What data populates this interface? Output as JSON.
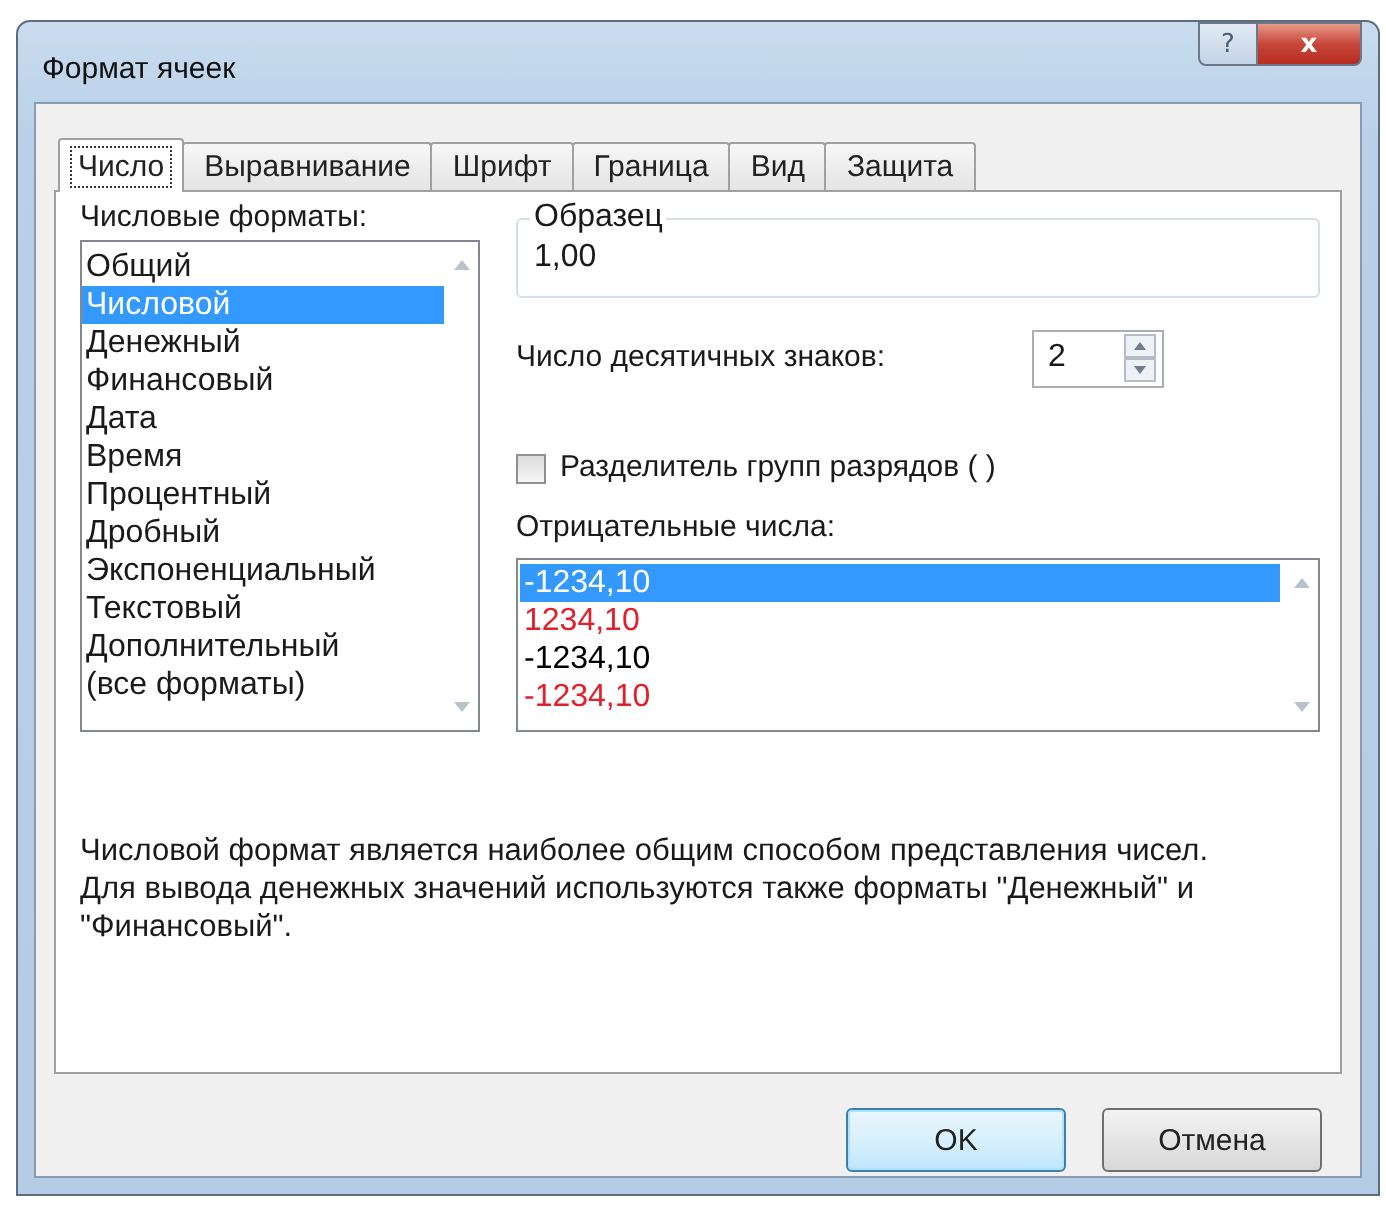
{
  "window": {
    "title": "Формат ячеек",
    "help_button": "?",
    "close_button": "x"
  },
  "tabs": [
    {
      "label": "Число",
      "selected": true
    },
    {
      "label": "Выравнивание",
      "selected": false
    },
    {
      "label": "Шрифт",
      "selected": false
    },
    {
      "label": "Граница",
      "selected": false
    },
    {
      "label": "Вид",
      "selected": false
    },
    {
      "label": "Защита",
      "selected": false
    }
  ],
  "formats": {
    "label": "Числовые форматы:",
    "items": [
      {
        "label": "Общий",
        "selected": false
      },
      {
        "label": "Числовой",
        "selected": true
      },
      {
        "label": "Денежный",
        "selected": false
      },
      {
        "label": "Финансовый",
        "selected": false
      },
      {
        "label": "Дата",
        "selected": false
      },
      {
        "label": "Время",
        "selected": false
      },
      {
        "label": "Процентный",
        "selected": false
      },
      {
        "label": "Дробный",
        "selected": false
      },
      {
        "label": "Экспоненциальный",
        "selected": false
      },
      {
        "label": "Текстовый",
        "selected": false
      },
      {
        "label": "Дополнительный",
        "selected": false
      },
      {
        "label": "(все форматы)",
        "selected": false
      }
    ]
  },
  "sample": {
    "label": "Образец",
    "value": "1,00"
  },
  "decimal_places": {
    "label": "Число десятичных знаков:",
    "value": "2"
  },
  "thousands_separator": {
    "label": "Разделитель групп разрядов ( )",
    "checked": false
  },
  "negative_numbers": {
    "label": "Отрицательные числа:",
    "items": [
      {
        "label": "-1234,10",
        "selected": true
      },
      {
        "label": "1234,10",
        "color": "#e0202a",
        "selected": false
      },
      {
        "label": "-1234,10",
        "color": "#000000",
        "selected": false
      },
      {
        "label": "-1234,10",
        "color": "#e0202a",
        "selected": false
      }
    ]
  },
  "description": "Числовой формат является наиболее общим способом представления чисел. Для вывода денежных значений используются также форматы \"Денежный\" и \"Финансовый\".",
  "buttons": [
    {
      "label": "OK",
      "kind": "default"
    },
    {
      "label": "Отмена",
      "kind": "normal"
    }
  ]
}
